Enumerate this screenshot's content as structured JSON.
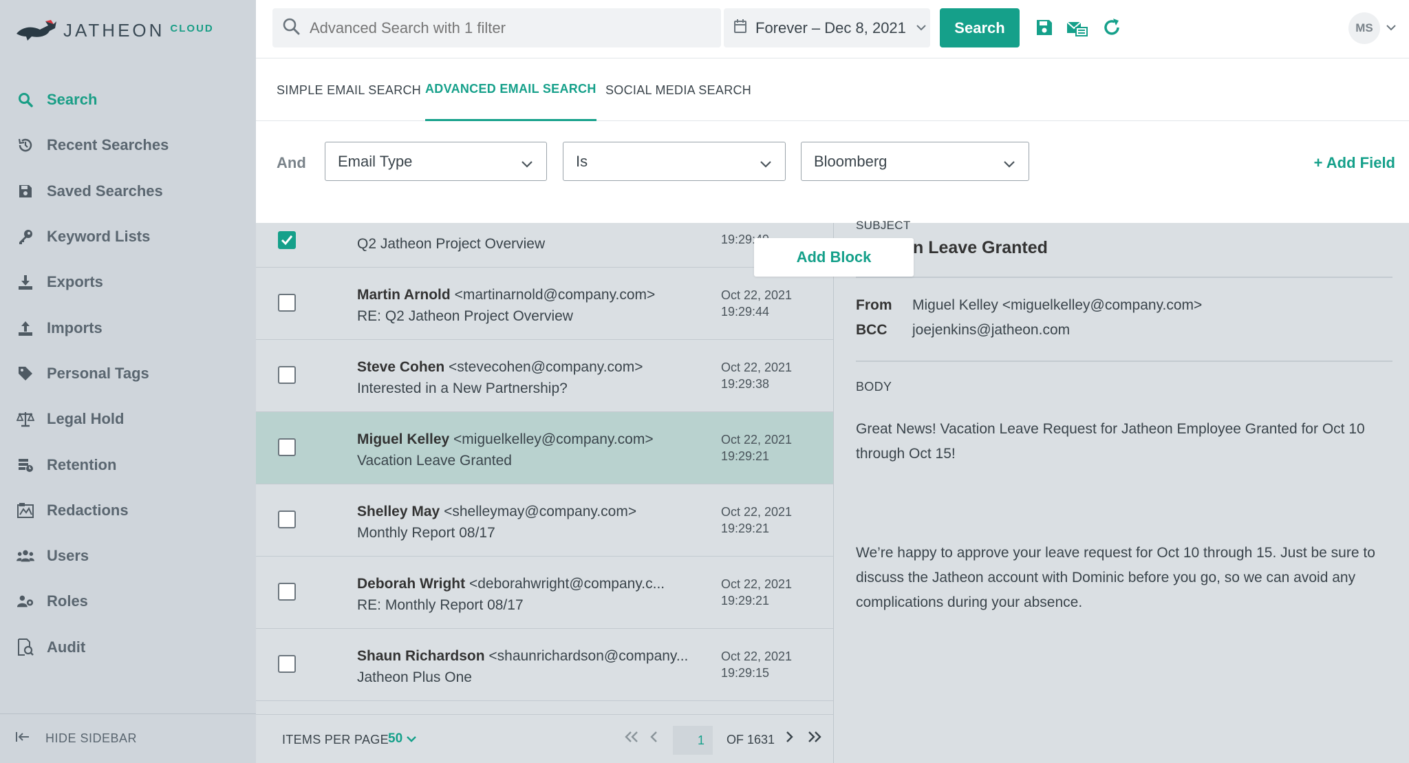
{
  "brand": {
    "name": "JATHEON",
    "suffix": "CLOUD"
  },
  "sidebar": {
    "items": [
      {
        "label": "Search",
        "icon": "search-icon",
        "active": true
      },
      {
        "label": "Recent Searches",
        "icon": "history-icon"
      },
      {
        "label": "Saved Searches",
        "icon": "save-icon"
      },
      {
        "label": "Keyword Lists",
        "icon": "key-icon"
      },
      {
        "label": "Exports",
        "icon": "download-icon"
      },
      {
        "label": "Imports",
        "icon": "upload-icon"
      },
      {
        "label": "Personal Tags",
        "icon": "tag-icon"
      },
      {
        "label": "Legal Hold",
        "icon": "scale-icon"
      },
      {
        "label": "Retention",
        "icon": "retention-icon"
      },
      {
        "label": "Redactions",
        "icon": "redaction-icon"
      },
      {
        "label": "Users",
        "icon": "users-icon"
      },
      {
        "label": "Roles",
        "icon": "roles-icon"
      },
      {
        "label": "Audit",
        "icon": "audit-icon"
      }
    ],
    "hide_label": "HIDE SIDEBAR"
  },
  "topbar": {
    "search_placeholder": "Advanced Search with 1 filter",
    "date_range": "Forever – Dec 8, 2021",
    "search_button": "Search",
    "avatar": "MS"
  },
  "tabs": [
    {
      "label": "SIMPLE EMAIL SEARCH"
    },
    {
      "label": "ADVANCED EMAIL SEARCH",
      "active": true
    },
    {
      "label": "SOCIAL MEDIA SEARCH"
    }
  ],
  "filter": {
    "conjunction": "And",
    "field": "Email Type",
    "operator": "Is",
    "value": "Bloomberg",
    "add_field": "+ Add Field"
  },
  "emails": [
    {
      "name": "",
      "email": "",
      "subject": "Q2 Jatheon Project Overview",
      "date": "",
      "time": "19:29:49",
      "checked": true
    },
    {
      "name": "Martin Arnold",
      "email": "<martinarnold@company.com>",
      "subject": "RE: Q2 Jatheon Project Overview",
      "date": "Oct 22, 2021",
      "time": "19:29:44"
    },
    {
      "name": "Steve Cohen",
      "email": "<stevecohen@company.com>",
      "subject": "Interested in a New Partnership?",
      "date": "Oct 22, 2021",
      "time": "19:29:38"
    },
    {
      "name": "Miguel Kelley",
      "email": "<miguelkelley@company.com>",
      "subject": "Vacation Leave Granted",
      "date": "Oct 22, 2021",
      "time": "19:29:21",
      "selected": true
    },
    {
      "name": "Shelley May",
      "email": "<shelleymay@company.com>",
      "subject": "Monthly Report 08/17",
      "date": "Oct 22, 2021",
      "time": "19:29:21"
    },
    {
      "name": "Deborah Wright",
      "email": "<deborahwright@company.c...",
      "subject": "RE: Monthly Report 08/17",
      "date": "Oct 22, 2021",
      "time": "19:29:21"
    },
    {
      "name": "Shaun Richardson",
      "email": "<shaunrichardson@company...",
      "subject": "Jatheon Plus One",
      "date": "Oct 22, 2021",
      "time": "19:29:15"
    }
  ],
  "add_block": "Add Block",
  "pager": {
    "items_per_page_label": "ITEMS PER PAGE",
    "items_per_page": "50",
    "page": "1",
    "of": "OF 1631"
  },
  "detail": {
    "subject_label": "SUBJECT",
    "subject": "n Leave Granted",
    "from_label": "From",
    "from": "Miguel Kelley <miguelkelley@company.com>",
    "bcc_label": "BCC",
    "bcc": "joejenkins@jatheon.com",
    "body_label": "BODY",
    "body_1": "Great News! Vacation Leave Request for Jatheon Employee Granted for Oct 10 through Oct 15!",
    "body_2": "We’re happy to approve your leave request for Oct 10 through 15. Just be sure to discuss the Jatheon account with Dominic before you go, so we can avoid any complications during your absence."
  },
  "colors": {
    "accent": "#15a08a",
    "sidebar_bg": "#cfd5db",
    "list_bg": "#dadfe3",
    "selected_row": "#b9d2cf"
  }
}
